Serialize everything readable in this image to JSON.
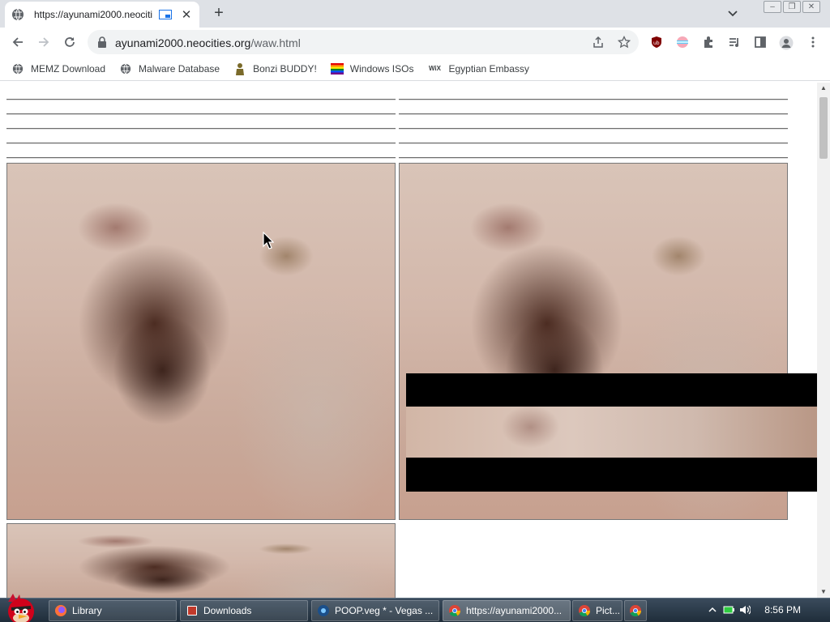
{
  "browser": {
    "tab_title": "https://ayunami2000.neociti",
    "tab_close": "✕",
    "new_tab": "+",
    "url_domain": "ayunami2000.neocities.org",
    "url_path": "/waw.html",
    "icons": [
      "back-icon",
      "forward-icon",
      "reload-icon",
      "lock-icon",
      "share-icon",
      "star-icon",
      "ublock-icon",
      "extension-icon",
      "puzzle-icon",
      "media-icon",
      "sidepanel-icon",
      "profile-icon",
      "menu-icon"
    ]
  },
  "window": {
    "minimize": "–",
    "maximize": "❐",
    "close": "✕"
  },
  "bookmarks": [
    {
      "label": "MEMZ Download",
      "icon": "globe-icon"
    },
    {
      "label": "Malware Database",
      "icon": "globe-icon"
    },
    {
      "label": "Bonzi BUDDY!",
      "icon": "bonzi-icon"
    },
    {
      "label": "Windows ISOs",
      "icon": "rainbow-flag-icon"
    },
    {
      "label": "Egyptian Embassy",
      "icon": "wix-icon"
    }
  ],
  "wix_text": "WiX",
  "taskbar": {
    "items": [
      {
        "label": "Library",
        "icon": "firefox-icon"
      },
      {
        "label": "Downloads",
        "icon": "folder-icon"
      },
      {
        "label": "POOP.veg * - Vegas ...",
        "icon": "vegas-icon"
      },
      {
        "label": "https://ayunami2000...",
        "icon": "chrome-icon"
      },
      {
        "label": "Pict...",
        "icon": "chrome-icon"
      },
      {
        "label": "",
        "icon": "chrome-icon"
      }
    ],
    "clock": "8:56 PM"
  },
  "colors": {
    "tab_strip": "#dee1e6",
    "taskbar": "#2b3a48",
    "accent": "#1a73e8"
  }
}
